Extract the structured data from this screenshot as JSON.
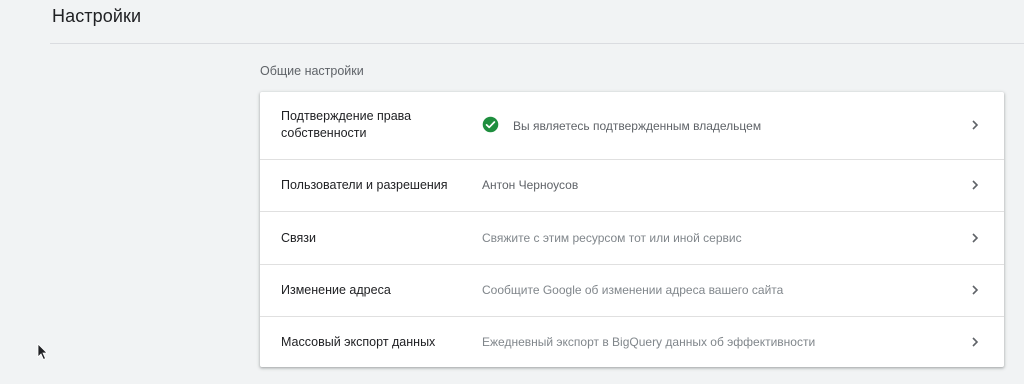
{
  "page": {
    "title": "Настройки"
  },
  "section": {
    "title": "Общие настройки"
  },
  "rows": [
    {
      "label": "Подтверждение права собственности",
      "value": "Вы являетесь подтвержденным владельцем",
      "icon": "check-circle-icon"
    },
    {
      "label": "Пользователи и разрешения",
      "value": "Антон Черноусов"
    },
    {
      "label": "Связи",
      "value": "Свяжите с этим ресурсом тот или иной сервис"
    },
    {
      "label": "Изменение адреса",
      "value": "Сообщите Google об изменении адреса вашего сайта"
    },
    {
      "label": "Массовый экспорт данных",
      "value": "Ежедневный экспорт в BigQuery данных об эффективности"
    }
  ],
  "colors": {
    "background": "#f1f3f4",
    "card": "#ffffff",
    "check": "#1e8e3e",
    "divider": "#e0e0e0"
  }
}
